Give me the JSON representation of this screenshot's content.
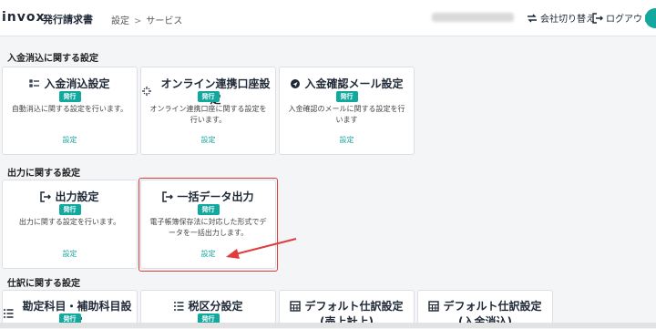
{
  "header": {
    "logo": "invox",
    "product": "発行請求書",
    "breadcrumb": [
      "設定",
      "サービス"
    ],
    "switch_company": "会社切り替え",
    "logout": "ログアウト"
  },
  "sections": [
    {
      "title": "入金消込に関する設定",
      "cards": [
        {
          "title": "入金消込設定",
          "icon": "checklist-icon",
          "badge": "発行",
          "desc": "自動消込に関する設定を行います。",
          "link": "設定"
        },
        {
          "title": "オンライン連携口座設定",
          "icon": "sparkle-icon",
          "badge": "発行",
          "desc": "オンライン連携口座に関する設定を行います。",
          "link": "設定"
        },
        {
          "title": "入金確認メール設定",
          "icon": "send-icon",
          "badge": "発行",
          "desc": "入金確認のメールに関する設定を行います",
          "link": "設定"
        }
      ]
    },
    {
      "title": "出力に関する設定",
      "cards": [
        {
          "title": "出力設定",
          "icon": "export-icon",
          "badge": "発行",
          "desc": "出力に関する設定を行います。",
          "link": "設定"
        },
        {
          "title": "一括データ出力",
          "icon": "export-icon",
          "badge": "発行",
          "desc": "電子帳簿保存法に対応した形式でデータを一括出力します。",
          "link": "設定"
        }
      ]
    },
    {
      "title": "仕訳に関する設定",
      "cards": [
        {
          "title": "勘定科目・補助科目設定",
          "icon": "list-icon",
          "badge": "発行"
        },
        {
          "title": "税区分設定",
          "icon": "list-icon",
          "badge": "発行"
        },
        {
          "title": "デフォルト仕訳設定",
          "subtitle": "(売上計上)",
          "icon": "table-icon"
        },
        {
          "title": "デフォルト仕訳設定",
          "subtitle": "(入金消込)",
          "icon": "table-icon"
        }
      ]
    }
  ],
  "colors": {
    "accent": "#13a89e",
    "highlight": "#e03c3c"
  }
}
